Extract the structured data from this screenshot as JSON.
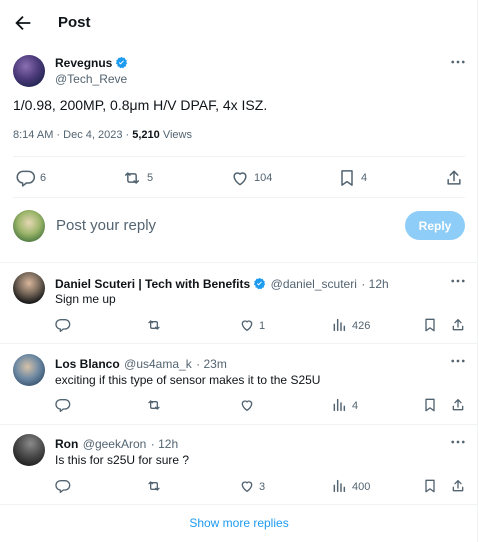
{
  "header": {
    "title": "Post"
  },
  "post": {
    "name": "Revegnus",
    "handle": "@Tech_Reve",
    "text": "1/0.98, 200MP, 0.8μm H/V DPAF, 4x ISZ.",
    "time": "8:14 AM · Dec 4, 2023 · ",
    "views_count": "5,210",
    "views_label": " Views",
    "stats": {
      "replies": "6",
      "reposts": "5",
      "likes": "104",
      "bookmarks": "4"
    }
  },
  "composer": {
    "placeholder": "Post your reply",
    "button": "Reply"
  },
  "replies": [
    {
      "name": "Daniel Scuteri | Tech with Benefits",
      "handle": "@daniel_scuteri",
      "time": "· 12h",
      "text": "Sign me up",
      "replies": "",
      "reposts": "",
      "likes": "1",
      "views": "426"
    },
    {
      "name": "Los Blanco",
      "handle": "@us4ama_k",
      "time": "· 23m",
      "text": "exciting if this type of sensor makes it to the S25U",
      "replies": "",
      "reposts": "",
      "likes": "",
      "views": "4"
    },
    {
      "name": "Ron",
      "handle": "@geekAron",
      "time": "· 12h",
      "text": "Is this for s25U for sure ?",
      "replies": "",
      "reposts": "",
      "likes": "3",
      "views": "400"
    }
  ],
  "footer": {
    "show_more": "Show more replies"
  },
  "colors": {
    "accent": "#1d9bf0",
    "reply_disabled": "#8ecdf8",
    "muted": "#536471"
  },
  "icons": [
    "back-arrow-icon",
    "verified-badge-icon",
    "more-icon",
    "comment-icon",
    "repost-icon",
    "like-icon",
    "bookmark-icon",
    "share-icon",
    "views-icon"
  ]
}
